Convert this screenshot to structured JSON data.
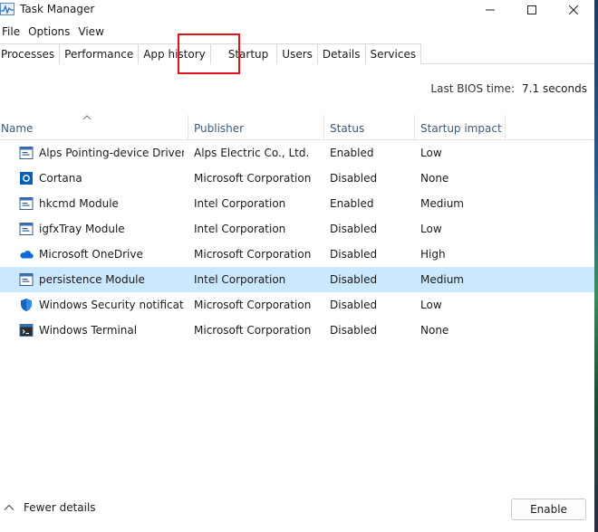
{
  "window": {
    "title": "Task Manager"
  },
  "menu": [
    "File",
    "Options",
    "View"
  ],
  "tabs": [
    {
      "label": "Processes"
    },
    {
      "label": "Performance"
    },
    {
      "label": "App history"
    },
    {
      "label": "Startup",
      "active": true
    },
    {
      "label": "Users"
    },
    {
      "label": "Details"
    },
    {
      "label": "Services"
    }
  ],
  "bios": {
    "label": "Last BIOS time:",
    "value": "7.1 seconds"
  },
  "columns": {
    "name": "Name",
    "publisher": "Publisher",
    "status": "Status",
    "impact": "Startup impact"
  },
  "rows": [
    {
      "icon": "app-window-icon",
      "name": "Alps Pointing-device Driver",
      "publisher": "Alps Electric Co., Ltd.",
      "status": "Enabled",
      "impact": "Low"
    },
    {
      "icon": "cortana-icon",
      "name": "Cortana",
      "publisher": "Microsoft Corporation",
      "status": "Disabled",
      "impact": "None"
    },
    {
      "icon": "app-window-icon",
      "name": "hkcmd Module",
      "publisher": "Intel Corporation",
      "status": "Enabled",
      "impact": "Medium"
    },
    {
      "icon": "app-window-icon",
      "name": "igfxTray Module",
      "publisher": "Intel Corporation",
      "status": "Disabled",
      "impact": "Low"
    },
    {
      "icon": "onedrive-cloud-icon",
      "name": "Microsoft OneDrive",
      "publisher": "Microsoft Corporation",
      "status": "Disabled",
      "impact": "High"
    },
    {
      "icon": "app-window-icon",
      "name": "persistence Module",
      "publisher": "Intel Corporation",
      "status": "Disabled",
      "impact": "Medium",
      "selected": true
    },
    {
      "icon": "shield-icon",
      "name": "Windows Security notificati...",
      "publisher": "Microsoft Corporation",
      "status": "Disabled",
      "impact": "Low"
    },
    {
      "icon": "terminal-icon",
      "name": "Windows Terminal",
      "publisher": "Microsoft Corporation",
      "status": "Disabled",
      "impact": "None"
    }
  ],
  "footer": {
    "fewer_details": "Fewer details",
    "enable_label": "Enable"
  },
  "colors": {
    "selection": "#cce8ff",
    "highlight_box": "#e0121a",
    "header_text": "#3a5a7a"
  }
}
